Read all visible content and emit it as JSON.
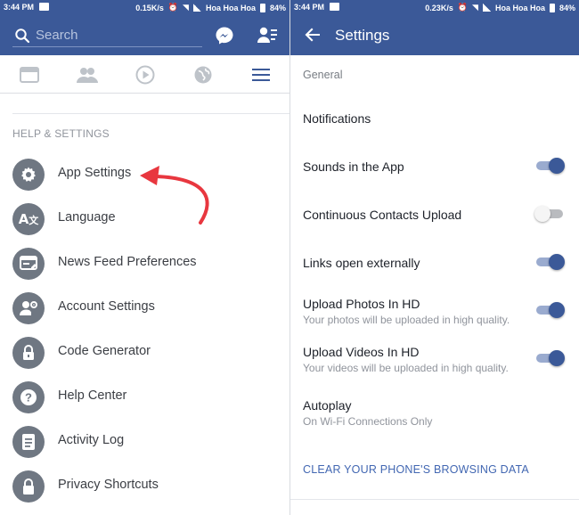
{
  "left": {
    "status": {
      "time": "3:44 PM",
      "speed": "0.15K/s",
      "carrier": "Hoa Hoa Hoa",
      "battery": "84%"
    },
    "search": {
      "placeholder": "Search"
    },
    "section_header": "HELP & SETTINGS",
    "menu": [
      {
        "label": "App Settings",
        "icon": "gear-icon"
      },
      {
        "label": "Language",
        "icon": "translate-icon"
      },
      {
        "label": "News Feed Preferences",
        "icon": "news-feed-icon"
      },
      {
        "label": "Account Settings",
        "icon": "account-settings-icon"
      },
      {
        "label": "Code Generator",
        "icon": "lock-icon"
      },
      {
        "label": "Help Center",
        "icon": "question-icon"
      },
      {
        "label": "Activity Log",
        "icon": "document-icon"
      },
      {
        "label": "Privacy Shortcuts",
        "icon": "padlock-icon"
      }
    ]
  },
  "right": {
    "status": {
      "time": "3:44 PM",
      "speed": "0.23K/s",
      "carrier": "Hoa Hoa Hoa",
      "battery": "84%"
    },
    "title": "Settings",
    "section": "General",
    "items": [
      {
        "title": "Notifications",
        "subtitle": ""
      },
      {
        "title": "Sounds in the App",
        "subtitle": "",
        "toggle": true
      },
      {
        "title": "Continuous Contacts Upload",
        "subtitle": "",
        "toggle": false
      },
      {
        "title": "Links open externally",
        "subtitle": "",
        "toggle": true
      },
      {
        "title": "Upload Photos In HD",
        "subtitle": "Your photos will be uploaded in high quality.",
        "toggle": true
      },
      {
        "title": "Upload Videos In HD",
        "subtitle": "Your videos will be uploaded in high quality.",
        "toggle": true
      },
      {
        "title": "Autoplay",
        "subtitle": "On Wi-Fi Connections Only"
      }
    ],
    "clear_link": "CLEAR YOUR PHONE'S BROWSING DATA"
  },
  "colors": {
    "brand": "#3b5998",
    "annotation_arrow": "#e8373f",
    "icon_circle": "#6f7782",
    "toggle_on": "#3b5998"
  }
}
